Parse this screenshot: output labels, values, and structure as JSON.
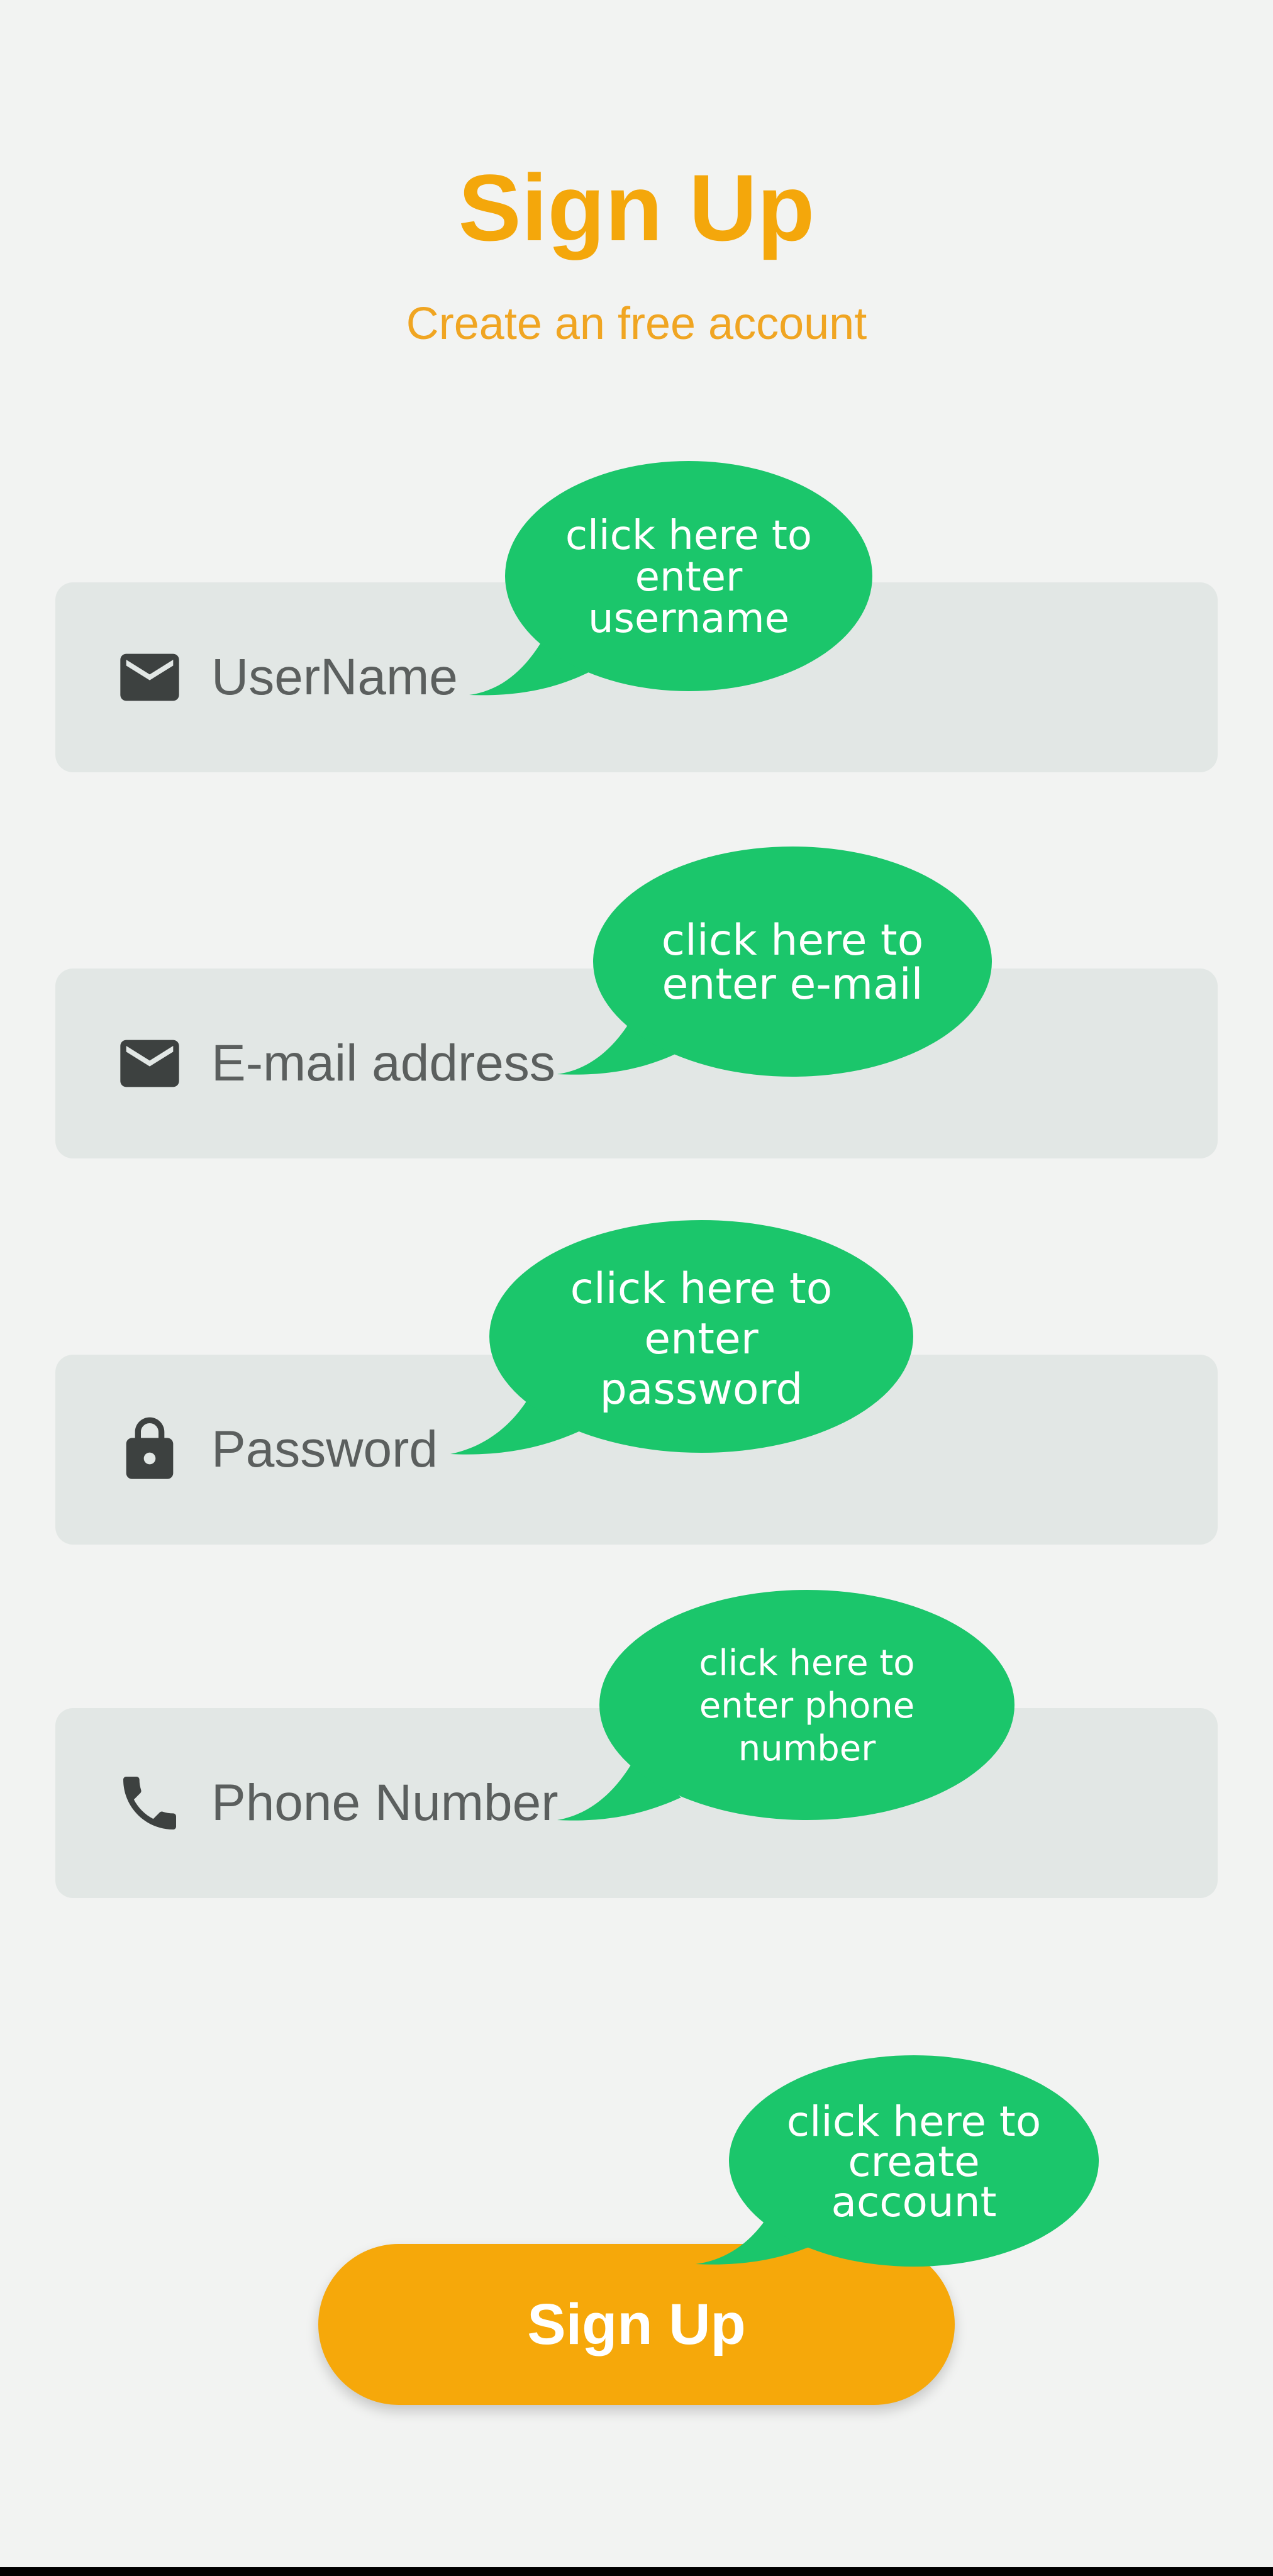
{
  "colors": {
    "accent": "#f4a70b",
    "bubble": "#1bc66b",
    "field_bg": "#e2e7e5",
    "icon": "#3d4140"
  },
  "header": {
    "title": "Sign Up",
    "subtitle": "Create an free account"
  },
  "fields": [
    {
      "icon": "mail-icon",
      "placeholder": "UserName"
    },
    {
      "icon": "mail-icon",
      "placeholder": "E-mail address"
    },
    {
      "icon": "lock-icon",
      "placeholder": "Password"
    },
    {
      "icon": "phone-icon",
      "placeholder": "Phone Number"
    }
  ],
  "tooltips": {
    "username": "click here to enter username",
    "email": "click here to enter e-mail",
    "password": "click here to enter password",
    "phone": "click here to enter phone number",
    "signup": "click here to create account"
  },
  "signup_button": {
    "label": "Sign Up"
  }
}
